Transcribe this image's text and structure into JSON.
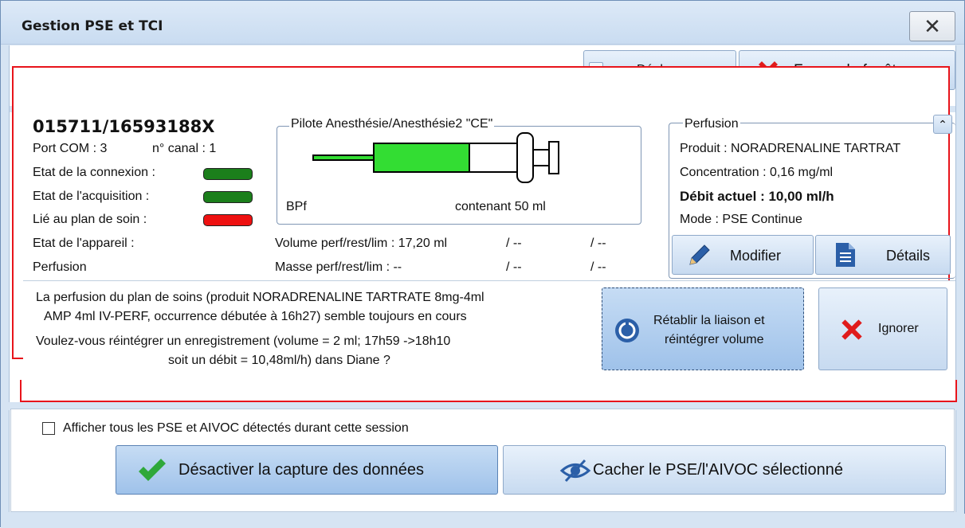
{
  "window": {
    "title": "Gestion PSE et TCI",
    "close_glyph": "✕"
  },
  "toolbar": {
    "deploy_label": "Déployer",
    "close_window_label": "Fermer la fenêtre"
  },
  "device": {
    "serial": "015711/16593188X",
    "port_com": "Port COM : 3",
    "channel": "n° canal : 1",
    "status_rows": [
      {
        "label": "Etat de la connexion :",
        "color": "#1b7f1b"
      },
      {
        "label": "Etat de l'acquisition :",
        "color": "#1b7f1b"
      },
      {
        "label": "Lié au plan de soin :",
        "color": "#ee1111"
      }
    ],
    "device_state_label": "Etat de l'appareil :",
    "perfusion_label": "Perfusion"
  },
  "pump": {
    "group_title": "Pilote Anesthésie/Anesthésie2 \"CE\"",
    "syringe_brand": "BPf",
    "syringe_capacity": "contenant 50 ml",
    "syringe_fill_level": 0.55,
    "syringe_fill_color": "#33dd33",
    "volume_line": {
      "label": "Volume perf/rest/lim : 17,20 ml",
      "rest": "/ --",
      "lim": "/ --"
    },
    "mass_line": {
      "label": "Masse perf/rest/lim :  --",
      "rest": "/ --",
      "lim": "/ --"
    }
  },
  "perfusion": {
    "group_title": "Perfusion",
    "collapse_glyph": "⌃",
    "produit": "Produit :  NORADRENALINE TARTRAT",
    "concentration": "Concentration : 0,16 mg/ml",
    "debit": "Débit actuel :  10,00 ml/h",
    "mode": "Mode :  PSE Continue",
    "modify_label": "Modifier",
    "details_label": "Détails"
  },
  "alert": {
    "line1": "La perfusion du plan de soins (produit NORADRENALINE TARTRATE 8mg-4ml",
    "line2": "AMP 4ml IV-PERF, occurrence débutée à 16h27) semble toujours en cours",
    "line3": "Voulez-vous réintégrer un enregistrement (volume = 2 ml; 17h59 ->18h10",
    "line4": "soit un débit = 10,48ml/h) dans Diane ?",
    "restore_label_1": "Rétablir la liaison et",
    "restore_label_2": "réintégrer volume",
    "ignore_label": "Ignorer"
  },
  "footer": {
    "show_all_label": "Afficher tous les PSE et AIVOC détectés durant cette session",
    "show_all_checked": false,
    "disable_capture_label": "Désactiver la capture des données",
    "hide_selected_label": "Cacher le PSE/l'AIVOC sélectionné"
  },
  "colors": {
    "accent_red": "#e8141b",
    "check_green": "#2fa83a",
    "window_blue": "#d6e4f3"
  }
}
